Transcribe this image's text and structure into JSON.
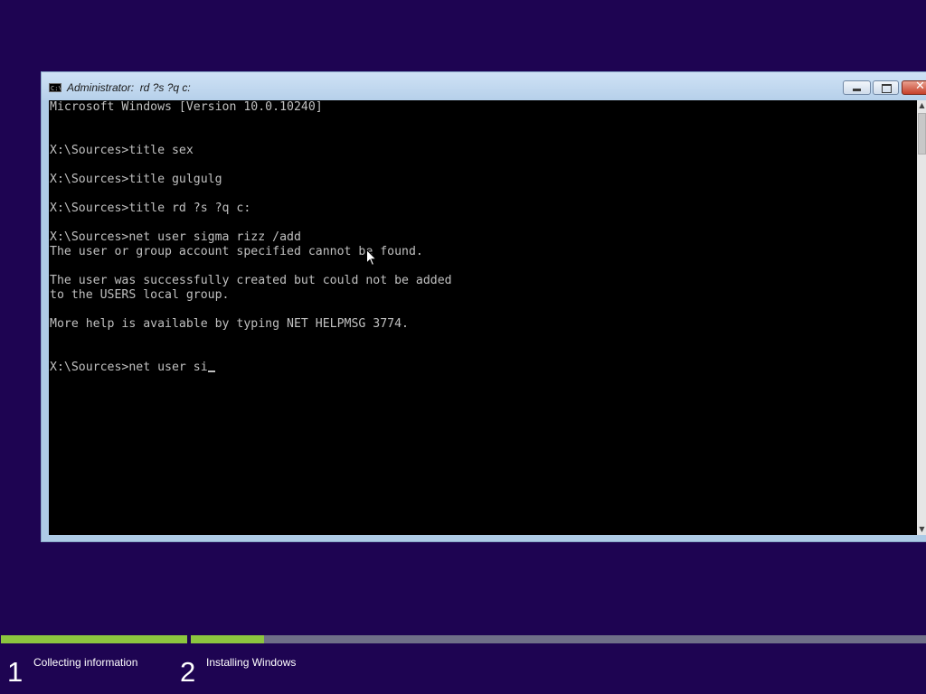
{
  "window": {
    "title": "Administrator:  rd ?s ?q c:",
    "icon": "console-icon",
    "icon_text": "C:\\",
    "controls": {
      "minimize": "minimize-icon",
      "maximize": "maximize-icon",
      "close": "close-icon",
      "close_glyph": "✕"
    }
  },
  "console": {
    "lines": [
      "Microsoft Windows [Version 10.0.10240]",
      "",
      "",
      "X:\\Sources>title sex",
      "",
      "X:\\Sources>title gulgulg",
      "",
      "X:\\Sources>title rd ?s ?q c:",
      "",
      "X:\\Sources>net user sigma rizz /add",
      "The user or group account specified cannot be found.",
      "",
      "The user was successfully created but could not be added",
      "to the USERS local group.",
      "",
      "More help is available by typing NET HELPMSG 3774.",
      "",
      "",
      "X:\\Sources>net user si"
    ],
    "colors": {
      "background": "#000000",
      "text": "#c0c0c0"
    }
  },
  "scrollbar": {
    "up": "▲",
    "down": "▼"
  },
  "setup": {
    "steps": [
      {
        "number": "1",
        "label": "Collecting information",
        "progress": 1.0
      },
      {
        "number": "2",
        "label": "Installing Windows",
        "progress": 0.1
      }
    ],
    "colors": {
      "background": "#1e0452",
      "progress": "#8cc63f",
      "track": "#6f6f88"
    }
  }
}
